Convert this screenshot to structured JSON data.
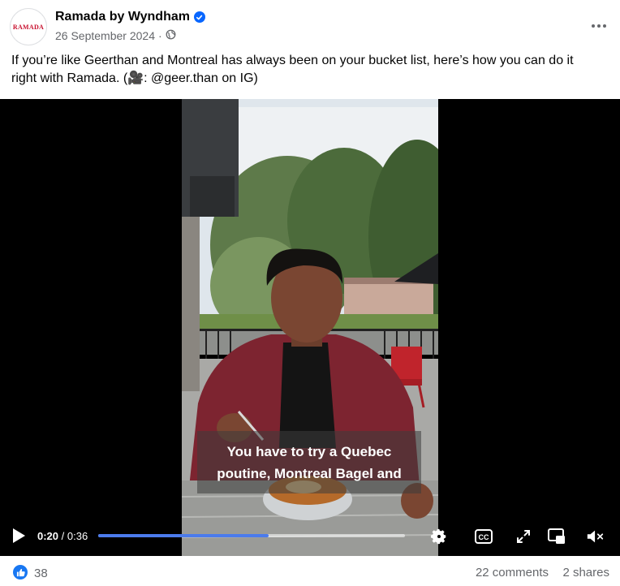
{
  "post": {
    "avatar_text": "RAMADA",
    "page_name": "Ramada by Wyndham",
    "date": "26 September 2024",
    "caption_line1": "If you’re like Geerthan and Montreal has always been on your bucket list, here’s how you can do it",
    "caption_line2": "right with Ramada. (🎥: @geer.than on IG)"
  },
  "video": {
    "subtitle_line1": "You have to try a Quebec",
    "subtitle_line2": "poutine, Montreal Bagel and",
    "current_time": "0:20",
    "separator": " / ",
    "total_time": "0:36",
    "progress_percent": 55.6
  },
  "icons": {
    "verified": "verified-badge-icon",
    "privacy": "globe-icon",
    "more": "more-options-icon",
    "play": "play-icon",
    "settings": "gear-icon",
    "captions": "closed-captions-icon",
    "fullscreen": "expand-icon",
    "pip": "picture-in-picture-icon",
    "mute": "muted-speaker-icon",
    "like": "thumbs-up-icon"
  },
  "colors": {
    "brand_blue": "#0866ff",
    "progress_fill": "#4b7bec",
    "ramada_red": "#c8102e"
  },
  "engagement": {
    "likes": "38",
    "comments": "22 comments",
    "shares": "2 shares"
  }
}
